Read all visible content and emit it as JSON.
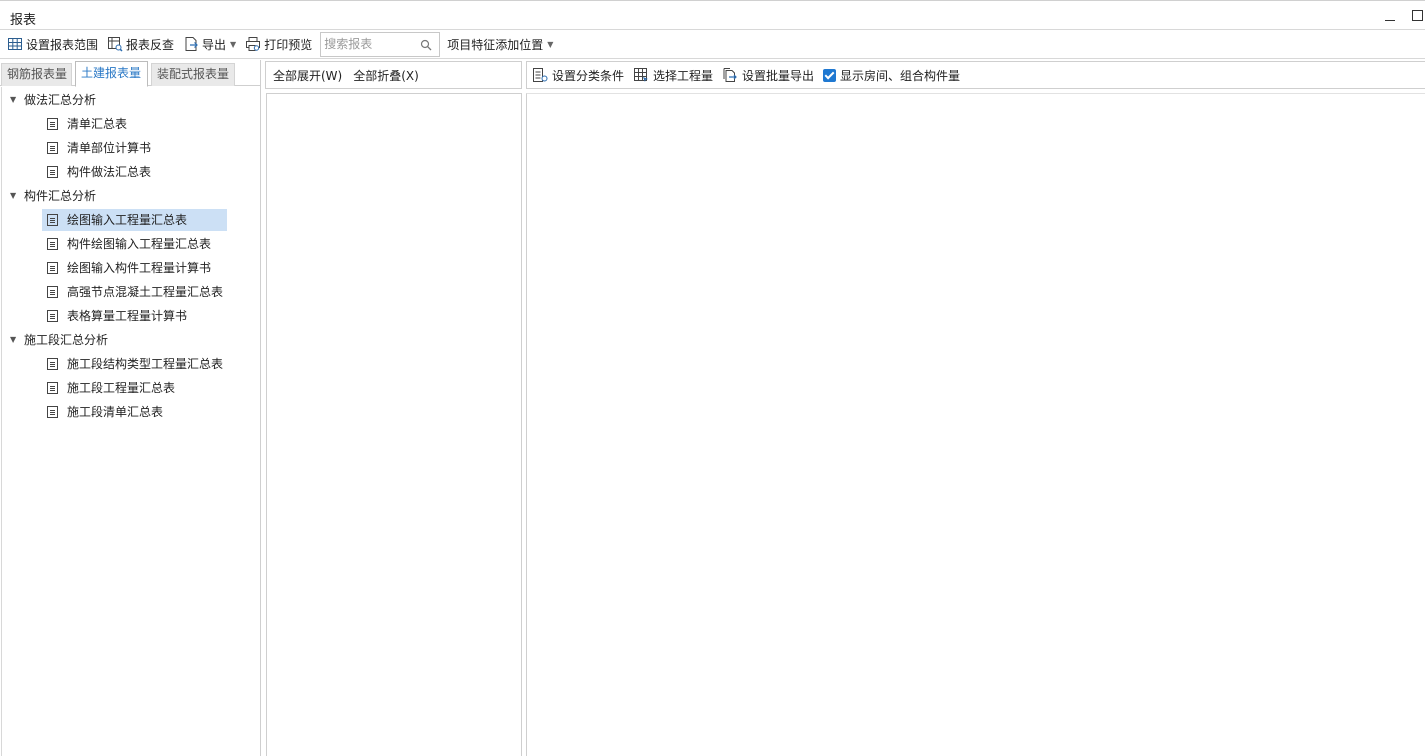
{
  "window": {
    "title": "报表"
  },
  "toolbar": {
    "set_range": "设置报表范围",
    "report_review": "报表反查",
    "export": "导出",
    "print_preview": "打印预览",
    "search_placeholder": "搜索报表",
    "feature_position": "项目特征添加位置"
  },
  "tabs": [
    "钢筋报表量",
    "土建报表量",
    "装配式报表量"
  ],
  "active_tab": "土建报表量",
  "tree": {
    "groups": [
      {
        "label": "做法汇总分析",
        "items": [
          "清单汇总表",
          "清单部位计算书",
          "构件做法汇总表"
        ]
      },
      {
        "label": "构件汇总分析",
        "items": [
          "绘图输入工程量汇总表",
          "构件绘图输入工程量汇总表",
          "绘图输入构件工程量计算书",
          "高强节点混凝土工程量汇总表",
          "表格算量工程量计算书"
        ]
      },
      {
        "label": "施工段汇总分析",
        "items": [
          "施工段结构类型工程量汇总表",
          "施工段工程量汇总表",
          "施工段清单汇总表"
        ]
      }
    ],
    "selected": "绘图输入工程量汇总表"
  },
  "middle_toolbar": {
    "expand_all": "全部展开(W)",
    "collapse_all": "全部折叠(X)"
  },
  "right_toolbar": {
    "set_classification": "设置分类条件",
    "select_quantity": "选择工程量",
    "batch_export": "设置批量导出",
    "show_room_checkbox": "显示房间、组合构件量",
    "show_room_checked": true
  },
  "colors": {
    "accent": "#2a78c6",
    "selected_row": "#cce0f5",
    "checkbox": "#1f78d1"
  }
}
